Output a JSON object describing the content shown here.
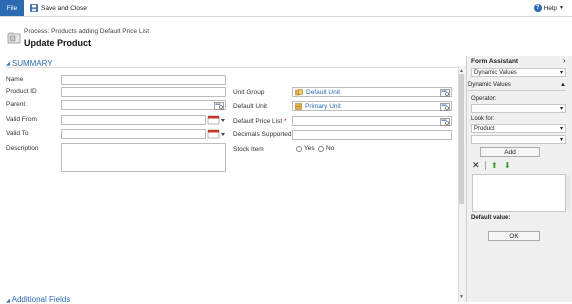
{
  "ribbon": {
    "file_label": "File",
    "save_close_label": "Save and Close",
    "help_label": "Help"
  },
  "header": {
    "process": "Process: Products adding Default Price List",
    "title": "Update Product"
  },
  "summary": {
    "section_label": "SUMMARY"
  },
  "left_fields": {
    "name": "Name",
    "product_id": "Product ID",
    "parent": "Parent",
    "valid_from": "Valid From",
    "valid_to": "Valid To",
    "description": "Description"
  },
  "right_fields": {
    "unit_group": "Unit Group",
    "unit_group_value": "Default Unit",
    "default_unit": "Default Unit",
    "default_unit_value": "Primary Unit",
    "default_price_list": "Default Price List",
    "required_mark": "*",
    "decimals_supported": "Decimals Supported",
    "stock_item": "Stock Item",
    "yes": "Yes",
    "no": "No"
  },
  "form_assistant": {
    "title": "Form Assistant",
    "dropdown_value": "Dynamic Values",
    "section": "Dynamic Values",
    "operator_label": "Operator:",
    "look_for_label": "Look for:",
    "look_for_value": "Product",
    "add_label": "Add",
    "default_value_label": "Default value:",
    "ok_label": "OK"
  },
  "additional": {
    "label": "Additional Fields"
  },
  "colors": {
    "accent": "#2c6ab1",
    "link": "#2c6ab1",
    "required": "#cc0000"
  }
}
